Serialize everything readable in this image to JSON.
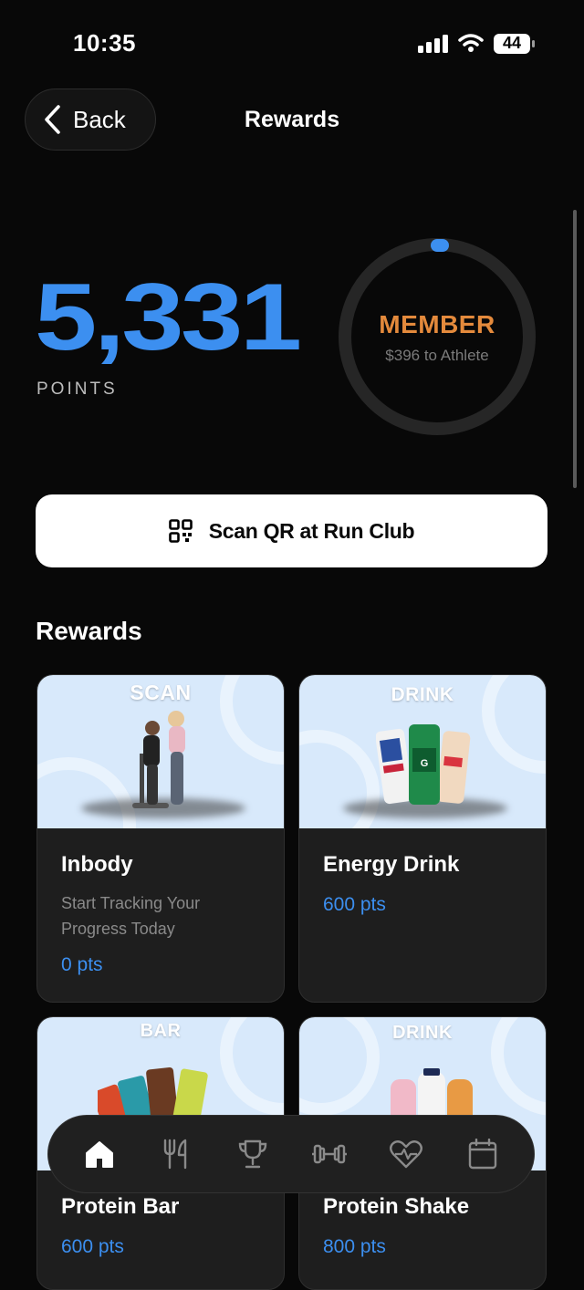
{
  "status": {
    "time": "10:35",
    "battery": "44"
  },
  "header": {
    "back_label": "Back",
    "title": "Rewards"
  },
  "points": {
    "value": "5,331",
    "label": "POINTS"
  },
  "tier": {
    "name": "MEMBER",
    "progress_text": "$396 to Athlete"
  },
  "scan_button": {
    "label": "Scan QR at Run Club"
  },
  "rewards_section": {
    "title": "Rewards"
  },
  "rewards": [
    {
      "category": "SCAN",
      "title": "Inbody",
      "description": "Start Tracking Your Progress Today",
      "points": "0 pts"
    },
    {
      "category": "DRINK",
      "title": "Energy Drink",
      "points": "600 pts"
    },
    {
      "category": "BAR",
      "title": "Protein Bar",
      "points": "600 pts"
    },
    {
      "category": "DRINK",
      "title": "Protein Shake",
      "points": "800 pts"
    }
  ],
  "tabbar": {
    "items": [
      "home-icon",
      "fork-knife-icon",
      "trophy-icon",
      "dumbbell-icon",
      "heartbeat-icon",
      "calendar-icon"
    ],
    "active": "home-icon"
  },
  "colors": {
    "accent": "#3c8ff0",
    "tier": "#e48a3c",
    "card_image_bg": "#d8e9fb"
  }
}
